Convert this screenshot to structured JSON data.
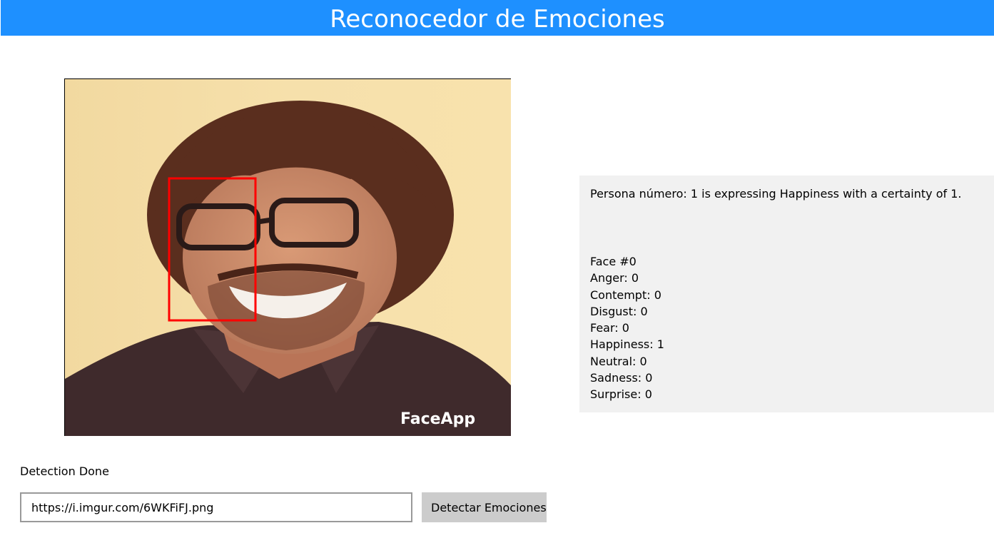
{
  "app": {
    "title": "Reconocedor de Emociones"
  },
  "photo": {
    "watermark": "FaceApp"
  },
  "results": {
    "summary": "Persona número: 1 is expressing Happiness with a certainty of 1.",
    "face_label": "Face #0",
    "emotions": [
      "Anger: 0",
      "Contempt: 0",
      "Disgust: 0",
      "Fear: 0",
      "Happiness: 1",
      "Neutral: 0",
      "Sadness: 0",
      "Surprise: 0"
    ]
  },
  "status": {
    "text": "Detection Done"
  },
  "form": {
    "url_value": "https://i.imgur.com/6WKFiFJ.png",
    "detect_label": "Detectar Emociones"
  },
  "colors": {
    "accent": "#1e90ff",
    "face_box": "#ff0000",
    "panel_bg": "#f1f1f1",
    "button_bg": "#cccccc"
  }
}
